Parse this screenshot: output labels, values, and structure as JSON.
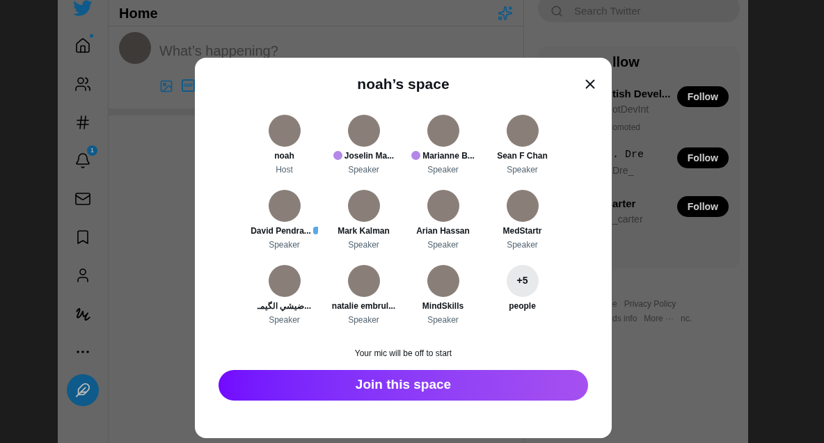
{
  "nav": {
    "notification_count": "1"
  },
  "main": {
    "title": "Home",
    "composer_placeholder": "What’s happening?",
    "gif_label": "GIF"
  },
  "search": {
    "placeholder": "Search Twitter"
  },
  "who_to_follow": {
    "title": "llow",
    "accounts": [
      {
        "name": "tish Devel...",
        "handle": "otDevInt",
        "note": "omoted",
        "button": "Follow"
      },
      {
        "name": ". Dre",
        "handle": "Dre_",
        "button": "Follow"
      },
      {
        "name": "arter",
        "handle": "_carter",
        "button": "Follow"
      }
    ]
  },
  "footer": {
    "links": [
      "e",
      "Privacy Policy",
      "ds info",
      "More ···",
      "nc."
    ]
  },
  "modal": {
    "title": "noah’s space",
    "participants": [
      {
        "kind": "photo",
        "name": "noah",
        "role": "Host",
        "speaking": false
      },
      {
        "kind": "photo",
        "name": "Joselin Ma...",
        "role": "Speaker",
        "color": "#b388e8",
        "speaking": false
      },
      {
        "kind": "photo",
        "name": "Marianne B...",
        "role": "Speaker",
        "color": "#b388e8",
        "speaking": false
      },
      {
        "kind": "photo",
        "name": "Sean F Chan",
        "role": "Speaker",
        "speaking": false
      },
      {
        "kind": "photo",
        "name": "David Pendra...",
        "role": "Speaker",
        "speaking": true
      },
      {
        "kind": "photo",
        "name": "Mark Kalman",
        "role": "Speaker",
        "speaking": false
      },
      {
        "kind": "photo",
        "name": "Arian Hassan",
        "role": "Speaker",
        "speaking": false
      },
      {
        "kind": "photo",
        "name": "MedStartr",
        "role": "Speaker",
        "speaking": false
      },
      {
        "kind": "photo",
        "name": "ضيشي الگيمـ...",
        "role": "Speaker",
        "speaking": false
      },
      {
        "kind": "photo",
        "name": "natalie embrul...",
        "role": "Speaker",
        "speaking": false
      },
      {
        "kind": "photo",
        "name": "MindSkills",
        "role": "Speaker",
        "speaking": false
      },
      {
        "kind": "count",
        "count": "+5",
        "name": "people",
        "speaking": false
      }
    ],
    "note": "Your mic will be off to start",
    "join_button": "Join this space"
  }
}
